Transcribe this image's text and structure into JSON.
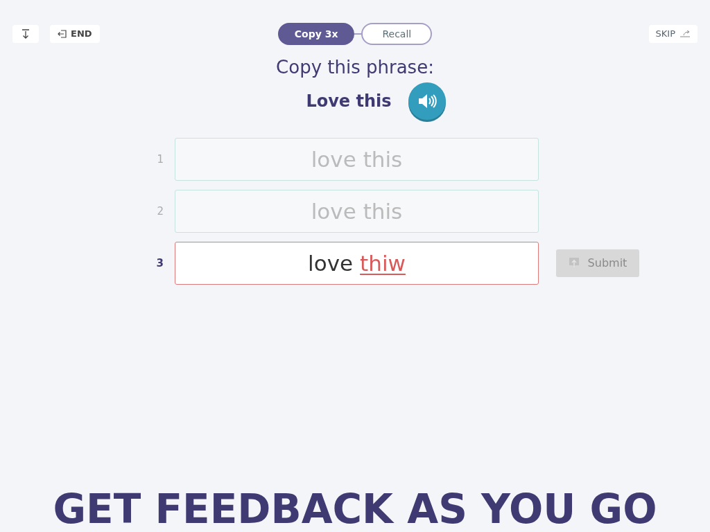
{
  "top_bar": {
    "end_label": "END",
    "modes": [
      {
        "label": "Copy 3x",
        "selected": true
      },
      {
        "label": "Recall",
        "selected": false
      }
    ],
    "skip_label": "SKIP"
  },
  "prompt": {
    "instruction": "Copy this phrase:",
    "phrase": "Love this"
  },
  "attempts": [
    {
      "number": "1",
      "active": false,
      "words": [
        {
          "text": "love",
          "wrong": false
        },
        {
          "text": "this",
          "wrong": false
        }
      ]
    },
    {
      "number": "2",
      "active": false,
      "words": [
        {
          "text": "love",
          "wrong": false
        },
        {
          "text": "this",
          "wrong": false
        }
      ]
    },
    {
      "number": "3",
      "active": true,
      "words": [
        {
          "text": "love",
          "wrong": false
        },
        {
          "text": "thiw",
          "wrong": true
        }
      ]
    }
  ],
  "submit": {
    "label": "Submit",
    "disabled": true
  },
  "banner": "GET FEEDBACK AS YOU GO"
}
